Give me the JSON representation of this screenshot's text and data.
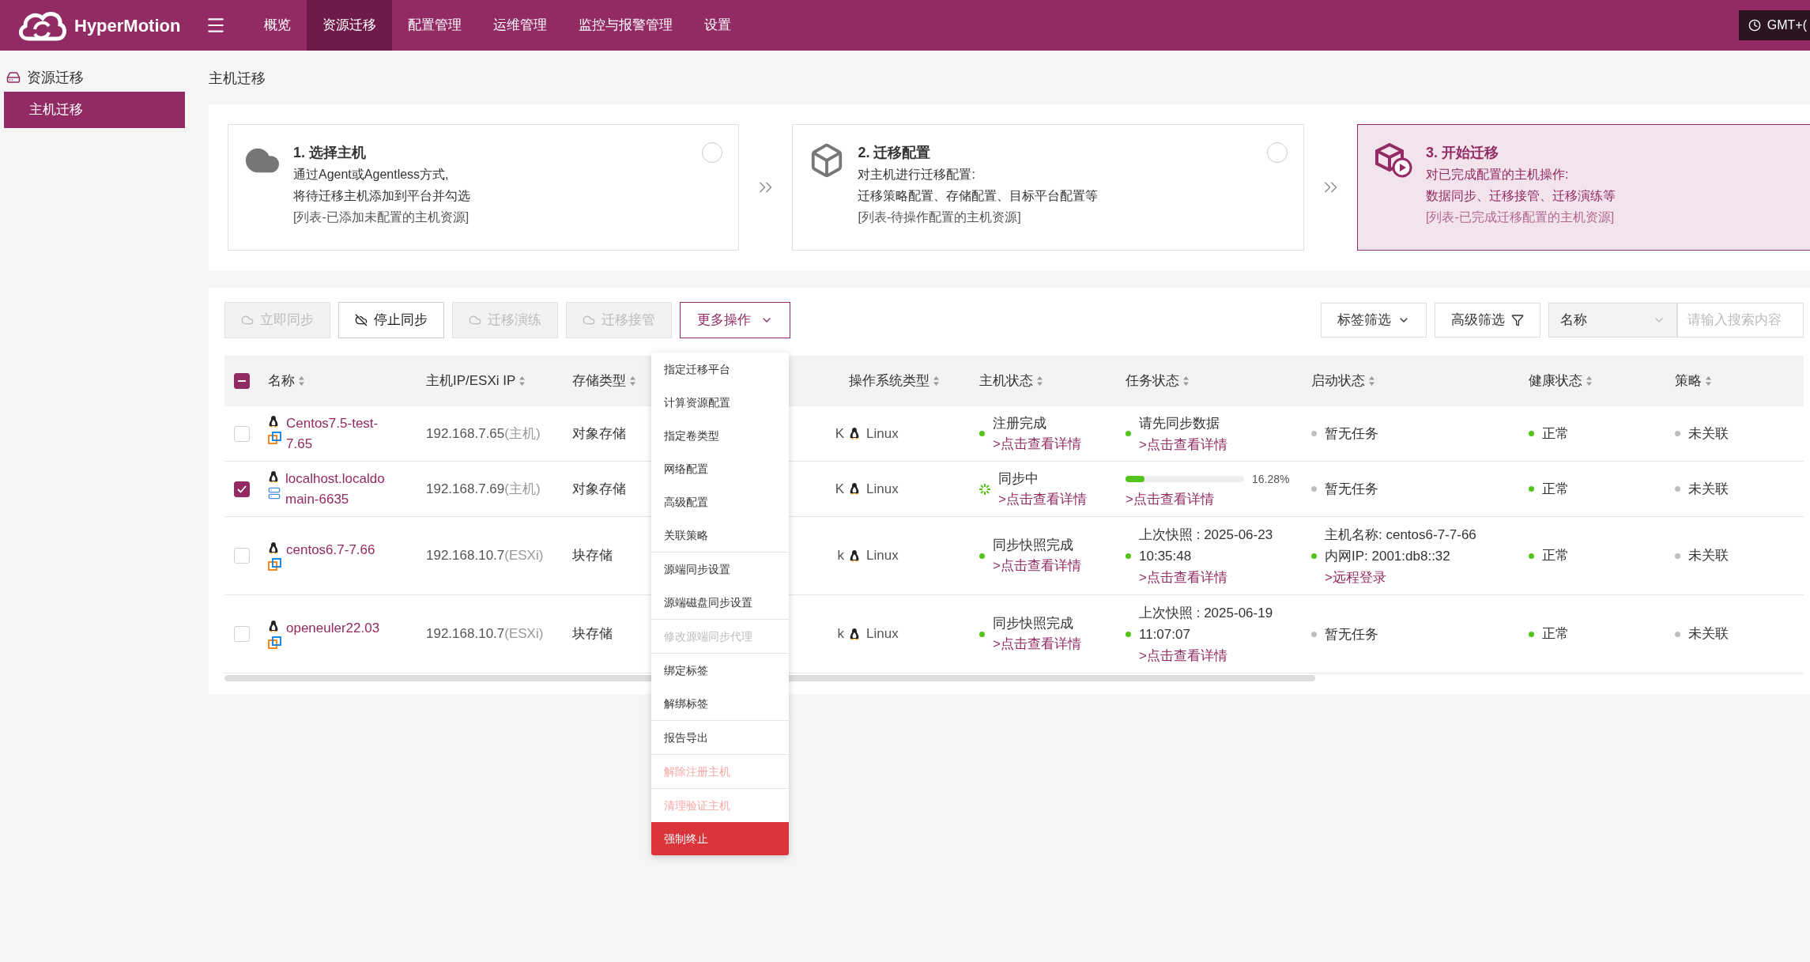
{
  "nav": {
    "brand": "HyperMotion",
    "items": [
      {
        "label": "概览",
        "selected": false
      },
      {
        "label": "资源迁移",
        "selected": true
      },
      {
        "label": "配置管理",
        "selected": false
      },
      {
        "label": "运维管理",
        "selected": false
      },
      {
        "label": "监控与报警管理",
        "selected": false
      },
      {
        "label": "设置",
        "selected": false
      }
    ],
    "time": "GMT+("
  },
  "sidebar": {
    "group": "资源迁移",
    "items": [
      {
        "label": "主机迁移",
        "selected": true
      }
    ]
  },
  "page_title": "主机迁移",
  "steps": [
    {
      "title": "1. 选择主机",
      "lines": [
        "通过Agent或Agentless方式,",
        "将待迁移主机添加到平台并勾选"
      ],
      "note": "[列表-已添加未配置的主机资源]",
      "selected": false,
      "kind": "cloud"
    },
    {
      "title": "2. 迁移配置",
      "lines": [
        "对主机进行迁移配置:",
        "迁移策略配置、存储配置、目标平台配置等"
      ],
      "note": "[列表-待操作配置的主机资源]",
      "selected": false,
      "kind": "gear"
    },
    {
      "title": "3. 开始迁移",
      "lines": [
        "对已完成配置的主机操作:",
        "数据同步、迁移接管、迁移演练等"
      ],
      "note": "[列表-已完成迁移配置的主机资源]",
      "selected": true,
      "kind": "play"
    }
  ],
  "toolbar": [
    {
      "label": "立即同步",
      "disabled": true
    },
    {
      "label": "停止同步",
      "disabled": false
    },
    {
      "label": "迁移演练",
      "disabled": true
    },
    {
      "label": "迁移接管",
      "disabled": true
    }
  ],
  "more_button": "更多操作",
  "filters": {
    "tag_filter": "标签筛选",
    "advanced_filter": "高级筛选",
    "field_select": "名称",
    "search_placeholder": "请输入搜索内容"
  },
  "table": {
    "select_all": {
      "indeterminate": true
    },
    "columns": [
      "名称",
      "主机IP/ESXi IP",
      "存储类型",
      "操作系统类型",
      "主机状态",
      "任务状态",
      "启动状态",
      "健康状态",
      "策略"
    ],
    "rows": [
      {
        "checked": false,
        "name": "Centos7.5-test-7.65",
        "kind": "vmware",
        "ip": "192.168.7.65",
        "ip_note": "(主机)",
        "storage": "对象存储",
        "column_4": "K",
        "os": "Linux",
        "host_status": {
          "kind": "dot",
          "color": "#52c41a",
          "text": "注册完成",
          "link": ">点击查看详情"
        },
        "task_status": {
          "kind": "text",
          "color": "#52c41a",
          "lines": [
            "请先同步数据"
          ],
          "link": ">点击查看详情"
        },
        "boot_status": {
          "color": "#bfbfbf",
          "lines": [
            "暂无任务"
          ]
        },
        "health": {
          "color": "#52c41a",
          "text": "正常"
        },
        "policy": {
          "color": "#bfbfbf",
          "text": "未关联"
        }
      },
      {
        "checked": true,
        "name": "localhost.localdomain-6635",
        "kind": "server",
        "ip": "192.168.7.69",
        "ip_note": "(主机)",
        "storage": "对象存储",
        "column_4": "K",
        "os": "Linux",
        "host_status": {
          "kind": "spinner",
          "color": "#52c41a",
          "text": "同步中",
          "link": ">点击查看详情"
        },
        "task_status": {
          "kind": "progress",
          "level": 0.1628,
          "reading": "16.28%",
          "link": ">点击查看详情"
        },
        "boot_status": {
          "color": "#bfbfbf",
          "lines": [
            "暂无任务"
          ]
        },
        "health": {
          "color": "#52c41a",
          "text": "正常"
        },
        "policy": {
          "color": "#bfbfbf",
          "text": "未关联"
        }
      },
      {
        "checked": false,
        "name": "centos6.7-7.66",
        "kind": "vmware",
        "ip": "192.168.10.7",
        "ip_note": "(ESXi)",
        "storage": "块存储",
        "column_4": "k",
        "os": "Linux",
        "host_status": {
          "kind": "dot",
          "color": "#52c41a",
          "text": "同步快照完成",
          "link": ">点击查看详情"
        },
        "task_status": {
          "kind": "text",
          "color": "#52c41a",
          "lines": [
            "上次快照 : 2025-06-23",
            "10:35:48"
          ],
          "link": ">点击查看详情"
        },
        "boot_status": {
          "color": "#52c41a",
          "lines": [
            "主机名称: centos6-7-7-66",
            "内网IP: 2001:db8::32"
          ],
          "link": ">远程登录"
        },
        "health": {
          "color": "#52c41a",
          "text": "正常"
        },
        "policy": {
          "color": "#bfbfbf",
          "text": "未关联"
        }
      },
      {
        "checked": false,
        "name": "openeuler22.03",
        "kind": "vmware",
        "ip": "192.168.10.7",
        "ip_note": "(ESXi)",
        "storage": "块存储",
        "column_4": "k",
        "os": "Linux",
        "host_status": {
          "kind": "dot",
          "color": "#52c41a",
          "text": "同步快照完成",
          "link": ">点击查看详情"
        },
        "task_status": {
          "kind": "text",
          "color": "#52c41a",
          "lines": [
            "上次快照 : 2025-06-19",
            "11:07:07"
          ],
          "link": ">点击查看详情"
        },
        "boot_status": {
          "color": "#bfbfbf",
          "lines": [
            "暂无任务"
          ]
        },
        "health": {
          "color": "#52c41a",
          "text": "正常"
        },
        "policy": {
          "color": "#bfbfbf",
          "text": "未关联"
        }
      }
    ]
  },
  "dropdown": [
    {
      "label": "指定迁移平台",
      "kind": "normal",
      "divider_above": false
    },
    {
      "label": "计算资源配置",
      "kind": "normal",
      "divider_above": false
    },
    {
      "label": "指定卷类型",
      "kind": "normal",
      "divider_above": false
    },
    {
      "label": "网络配置",
      "kind": "normal",
      "divider_above": false
    },
    {
      "label": "高级配置",
      "kind": "normal",
      "divider_above": false
    },
    {
      "label": "关联策略",
      "kind": "normal",
      "divider_above": false
    },
    {
      "label": "源端同步设置",
      "kind": "normal",
      "divider_above": true
    },
    {
      "label": "源端磁盘同步设置",
      "kind": "normal",
      "divider_above": false
    },
    {
      "label": "修改源端同步代理",
      "kind": "disabled",
      "divider_above": true
    },
    {
      "label": "绑定标签",
      "kind": "normal",
      "divider_above": true
    },
    {
      "label": "解绑标签",
      "kind": "normal",
      "divider_above": false
    },
    {
      "label": "报告导出",
      "kind": "normal",
      "divider_above": true
    },
    {
      "label": "解除注册主机",
      "kind": "danger_disabled",
      "divider_above": true
    },
    {
      "label": "清理验证主机",
      "kind": "danger_disabled",
      "divider_above": true
    },
    {
      "label": "强制终止",
      "kind": "danger_active",
      "divider_above": false
    }
  ]
}
